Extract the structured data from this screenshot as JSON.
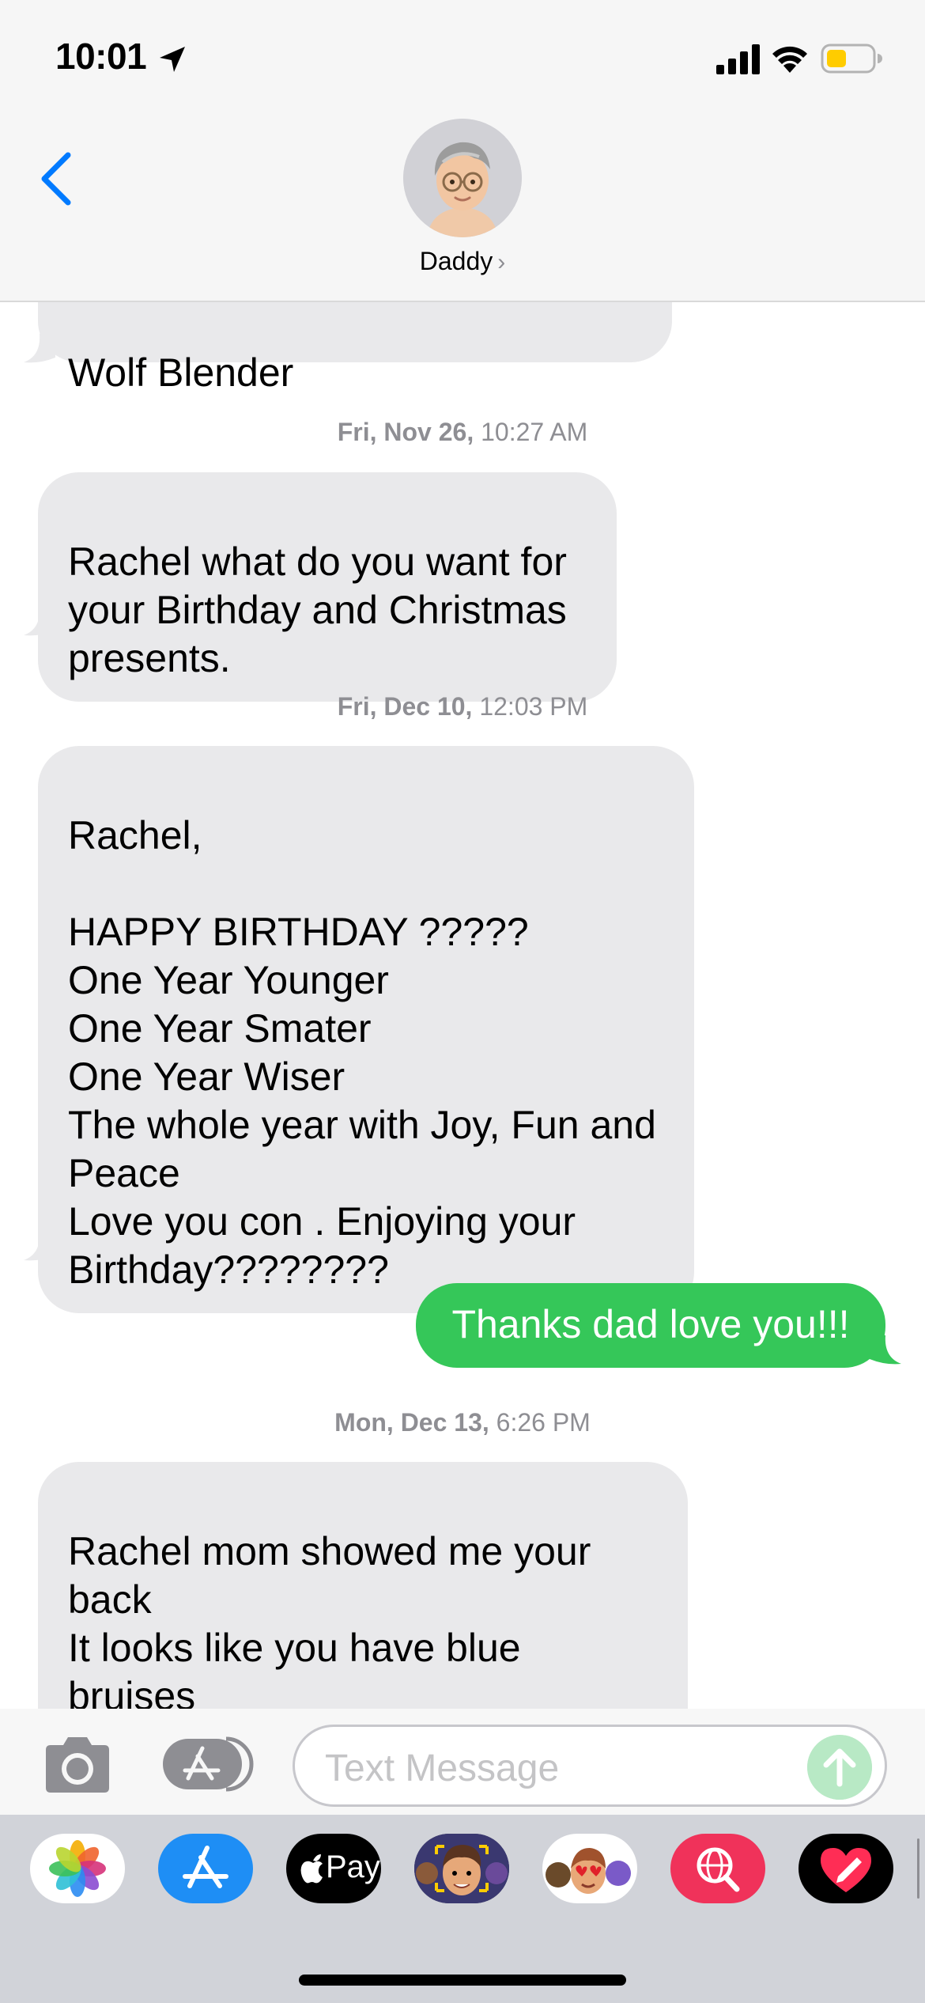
{
  "status_bar": {
    "time": "10:01"
  },
  "header": {
    "contact_name": "Daddy",
    "contact_chevron": "›"
  },
  "messages": {
    "first_partial_text": "Wolf Blender",
    "timestamp_1_day": "Fri, Nov 26,",
    "timestamp_1_time": " 10:27 AM",
    "msg_1": "Rachel what do you want for\nyour Birthday and Christmas\npresents.",
    "timestamp_2_day": "Fri, Dec 10,",
    "timestamp_2_time": " 12:03 PM",
    "msg_2": "Rachel,\n\nHAPPY BIRTHDAY ?????\nOne Year Younger\nOne Year Smater\nOne Year Wiser\nThe whole year with Joy, Fun and\nPeace\nLove you con . Enjoying your\nBirthday????????",
    "reply_1": "Thanks dad love you!!!",
    "timestamp_3_day": "Mon, Dec 13,",
    "timestamp_3_time": " 6:26 PM",
    "msg_3": "Rachel mom showed me your\nback\n It looks like you have blue\nbruises"
  },
  "input_bar": {
    "placeholder": "Text Message"
  },
  "app_drawer": {
    "apple_pay_label": "Pay"
  },
  "colors": {
    "sent_bubble": "#35c759",
    "received_bubble": "#e9e9eb",
    "accent": "#007aff"
  },
  "icons": [
    "location-arrow-icon",
    "cellular-signal-icon",
    "wifi-icon",
    "battery-icon",
    "back-chevron-icon",
    "camera-icon",
    "app-store-icon",
    "send-arrow-icon",
    "photos-icon",
    "apple-pay-icon",
    "memoji-icon",
    "animoji-stickers-icon",
    "web-search-icon",
    "digital-touch-icon"
  ]
}
